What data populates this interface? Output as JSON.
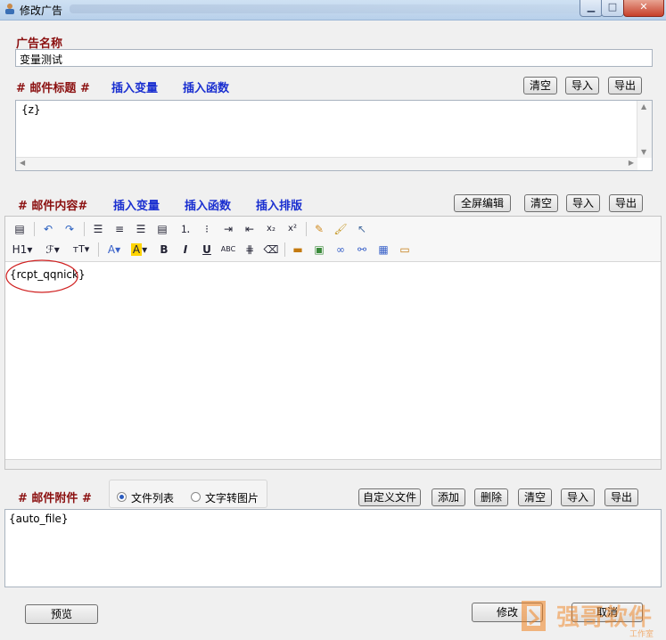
{
  "window": {
    "title": "修改广告"
  },
  "ad_name": {
    "label": "广告名称",
    "value": "变量测试"
  },
  "subject": {
    "label": "# 邮件标题 #",
    "insert_var": "插入变量",
    "insert_func": "插入函数",
    "clear": "清空",
    "import": "导入",
    "export": "导出",
    "value": "{z}"
  },
  "content": {
    "label": "# 邮件内容#",
    "insert_var": "插入变量",
    "insert_func": "插入函数",
    "insert_layout": "插入排版",
    "fullscreen": "全屏编辑",
    "clear": "清空",
    "import": "导入",
    "export": "导出",
    "value": "{rcpt_qqnick}",
    "toolbar_row1": [
      "source-icon",
      "undo-icon",
      "redo-icon",
      "align-left-icon",
      "align-center-icon",
      "align-right-icon",
      "justify-icon",
      "ordered-list-icon",
      "unordered-list-icon",
      "indent-icon",
      "outdent-icon",
      "subscript-icon",
      "superscript-icon",
      "clear-format-icon",
      "format-painter-icon",
      "select-icon"
    ],
    "toolbar_row2": [
      "heading-icon",
      "font-family-icon",
      "font-size-icon",
      "font-color-icon",
      "highlight-icon",
      "bold-icon",
      "italic-icon",
      "underline-icon",
      "strikethrough-icon",
      "horizontal-rule-icon",
      "eraser-icon",
      "image-icon",
      "insert-image-icon",
      "link-icon",
      "unlink-icon",
      "table-icon",
      "insert-row-icon"
    ]
  },
  "attachment": {
    "label": "# 邮件附件 #",
    "mode_list": "文件列表",
    "mode_text2img": "文字转图片",
    "selected_mode": "文件列表",
    "custom_file": "自定义文件",
    "add": "添加",
    "delete": "删除",
    "clear": "清空",
    "import": "导入",
    "export": "导出",
    "value": "{auto_file}"
  },
  "footer": {
    "preview": "预览",
    "modify": "修改",
    "cancel": "取消"
  },
  "watermark": {
    "text": "强哥软件",
    "sub": "工作室"
  },
  "colors": {
    "label_red": "#8b1010",
    "link_blue": "#1a2fd0",
    "annotation_red": "#d02020"
  }
}
